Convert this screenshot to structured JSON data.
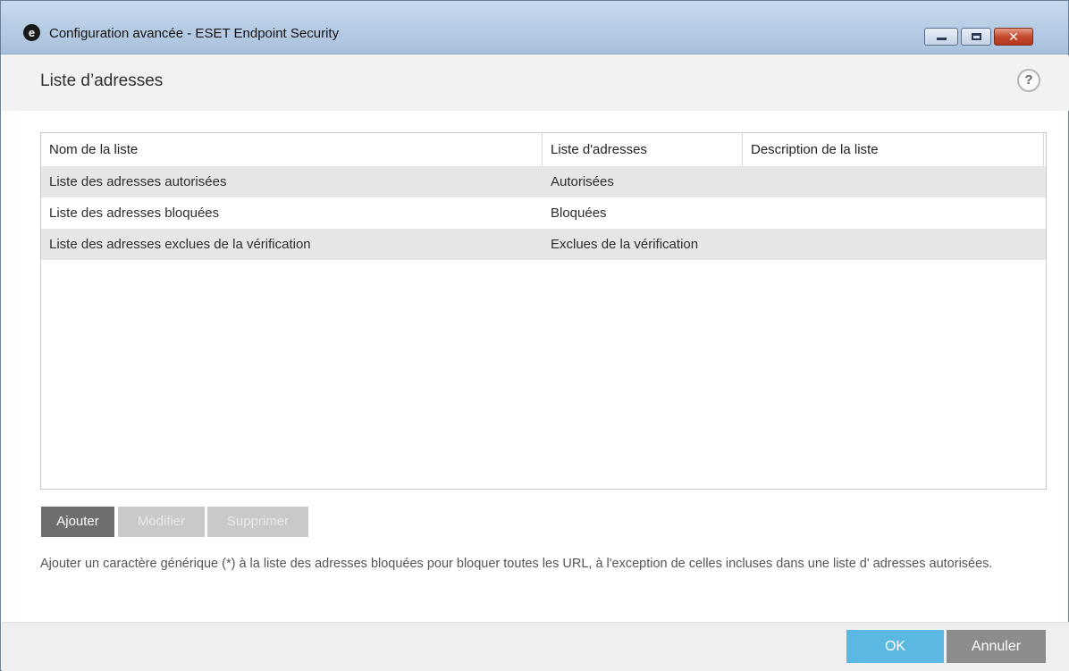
{
  "window": {
    "title": "Configuration avancée - ESET Endpoint Security",
    "app_icon_glyph": "e",
    "min_glyph": "",
    "max_glyph": "",
    "close_glyph": "✕"
  },
  "header": {
    "title": "Liste d’adresses",
    "help_glyph": "?"
  },
  "table": {
    "columns": [
      "Nom de la liste",
      "Liste d'adresses",
      "Description de la liste"
    ],
    "rows": [
      [
        "Liste des adresses autorisées",
        "Autorisées",
        ""
      ],
      [
        "Liste des adresses bloquées",
        "Bloquées",
        ""
      ],
      [
        "Liste des adresses exclues de la vérification",
        "Exclues de la vérification",
        ""
      ]
    ]
  },
  "actions": {
    "add_label": "Ajouter",
    "edit_label": "Modifier",
    "delete_label": "Supprimer"
  },
  "hint": "Ajouter un caractère générique (*) à la liste des adresses bloquées pour bloquer toutes les URL, à l'exception de celles incluses dans une liste d' adresses autorisées.",
  "footer": {
    "ok_label": "OK",
    "cancel_label": "Annuler"
  },
  "colors": {
    "ok_button": "#5bb8e2",
    "cancel_button": "#8c8c8c",
    "add_button": "#6e6e6e",
    "disabled_button": "#c9c9c9"
  },
  "icons": [
    "eset-logo-icon",
    "minimize-icon",
    "maximize-icon",
    "close-icon",
    "help-icon"
  ]
}
